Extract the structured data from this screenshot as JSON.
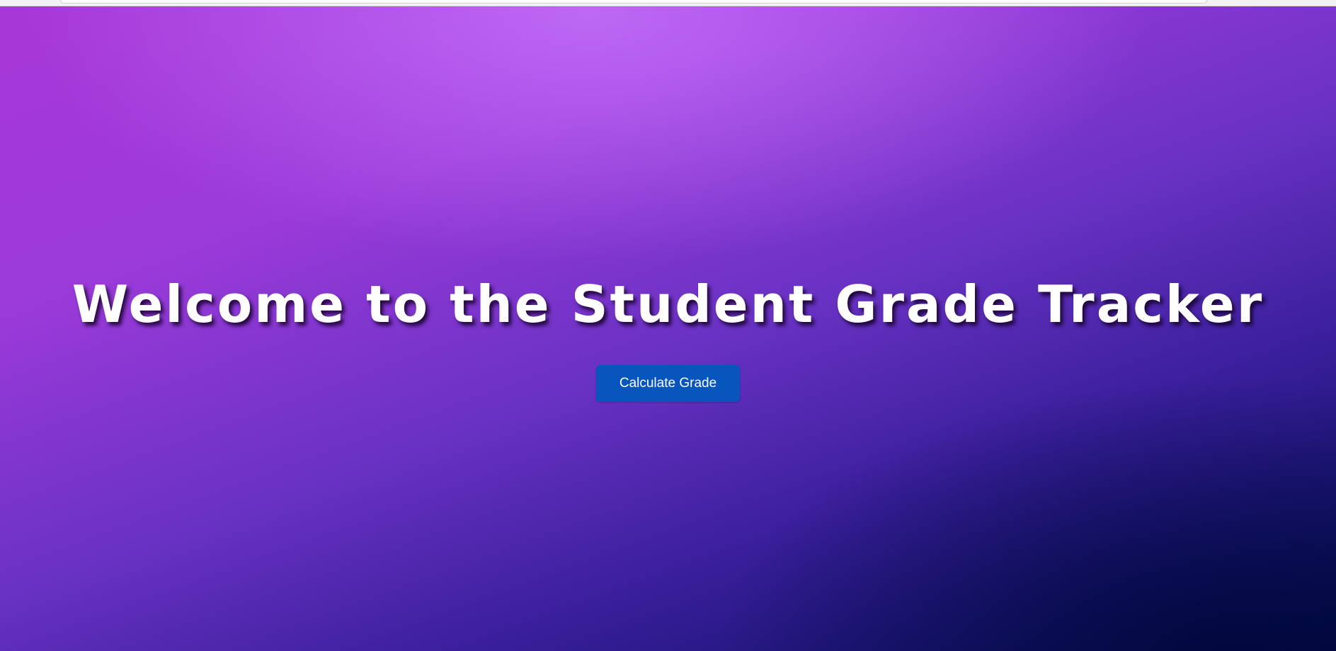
{
  "hero": {
    "title": "Welcome to the Student Grade Tracker",
    "button_label": "Calculate Grade"
  },
  "colors": {
    "button_bg": "#0656bd",
    "title_text": "#ffffff",
    "gradient_start": "#a937d8",
    "gradient_end": "#020a45"
  }
}
